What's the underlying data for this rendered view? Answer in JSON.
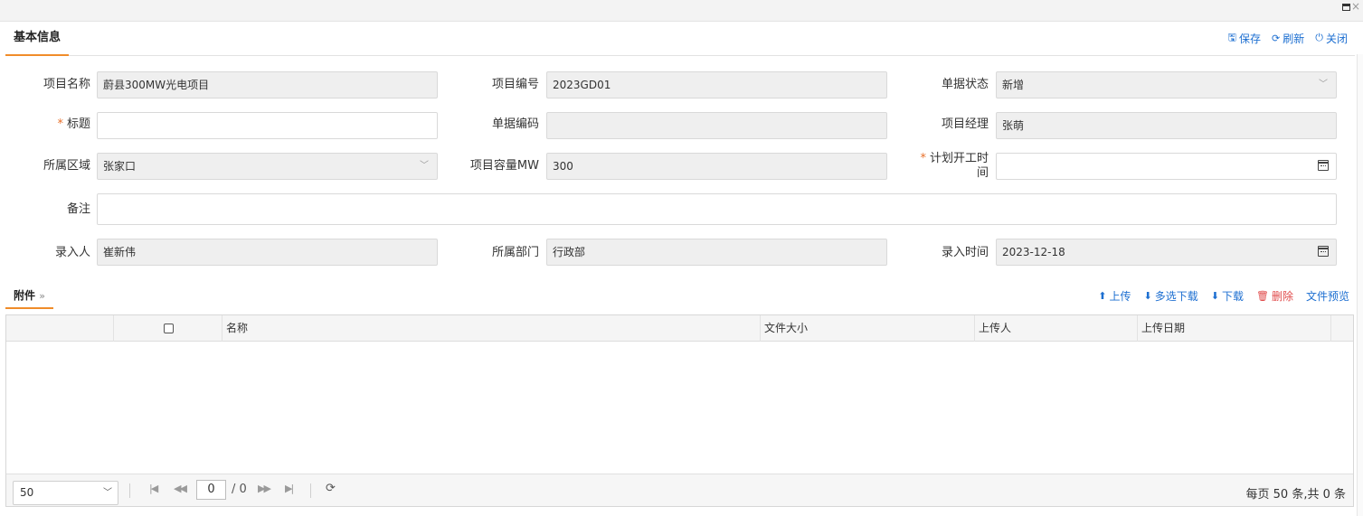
{
  "window": {
    "max_symbol": "",
    "close_symbol": "×"
  },
  "basic": {
    "title": "基本信息",
    "toolbar": {
      "save": "保存",
      "refresh": "刷新",
      "close": "关闭"
    },
    "fields": {
      "project_name": {
        "label": "项目名称",
        "value": "蔚县300MW光电项目"
      },
      "project_no": {
        "label": "项目编号",
        "value": "2023GD01"
      },
      "doc_status": {
        "label": "单据状态",
        "value": "新增"
      },
      "title": {
        "label": "标题",
        "value": "",
        "required_mark": "*"
      },
      "doc_code": {
        "label": "单据编码",
        "value": ""
      },
      "pm": {
        "label": "项目经理",
        "value": "张萌"
      },
      "region": {
        "label": "所属区域",
        "value": "张家口"
      },
      "capacity": {
        "label": "项目容量MW",
        "value": "300"
      },
      "plan_start": {
        "label_line1": "计划开工时",
        "label_line2": "间",
        "value": "",
        "required_mark": "*"
      },
      "remark": {
        "label": "备注",
        "value": ""
      },
      "entered_by": {
        "label": "录入人",
        "value": "崔新伟"
      },
      "dept": {
        "label": "所属部门",
        "value": "行政部"
      },
      "entered_at": {
        "label": "录入时间",
        "value": "2023-12-18"
      }
    }
  },
  "attachments": {
    "title": "附件",
    "title_arrow": "»",
    "toolbar": {
      "upload": "上传",
      "multi_download": "多选下载",
      "download": "下载",
      "delete": "删除",
      "preview": "文件预览"
    },
    "columns": {
      "name": "名称",
      "size": "文件大小",
      "uploader": "上传人",
      "date": "上传日期"
    },
    "rows": [],
    "pager": {
      "page_size": "50",
      "current": "0",
      "total_pages": "/ 0",
      "info": "每页 50 条,共 0 条"
    }
  },
  "colors": {
    "accent_orange": "#f08c2a",
    "link_blue": "#1d6fd1",
    "danger_red": "#e04a4a",
    "readonly_bg": "#efefef"
  }
}
